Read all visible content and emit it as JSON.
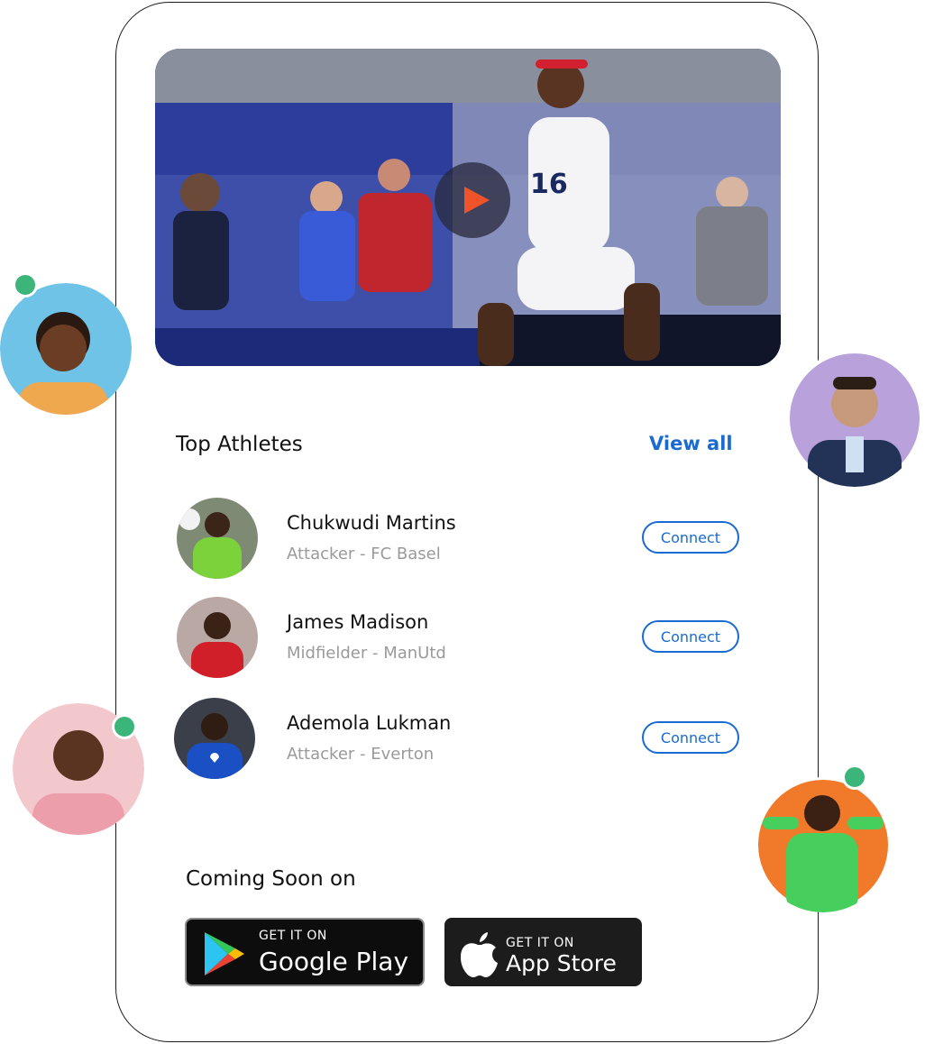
{
  "section": {
    "title": "Top Athletes",
    "view_all": "View all"
  },
  "athletes": [
    {
      "name": "Chukwudi Martins",
      "role": "Attacker - FC Basel",
      "action": "Connect",
      "jersey_color": "#7bd23a"
    },
    {
      "name": "James Madison",
      "role": "Midfielder - ManUtd",
      "action": "Connect",
      "jersey_color": "#d11f2a"
    },
    {
      "name": "Ademola Lukman",
      "role": "Attacker - Everton",
      "action": "Connect",
      "jersey_color": "#1b4fc4"
    }
  ],
  "coming_soon": "Coming Soon on",
  "stores": {
    "google": {
      "small": "GET IT ON",
      "big": "Google Play"
    },
    "apple": {
      "small": "GET IT ON",
      "big": "App Store"
    }
  },
  "video": {
    "jersey_number": "16"
  },
  "colors": {
    "accent": "#1a6bd1",
    "online": "#3bb57a",
    "play": "#f0532a"
  }
}
